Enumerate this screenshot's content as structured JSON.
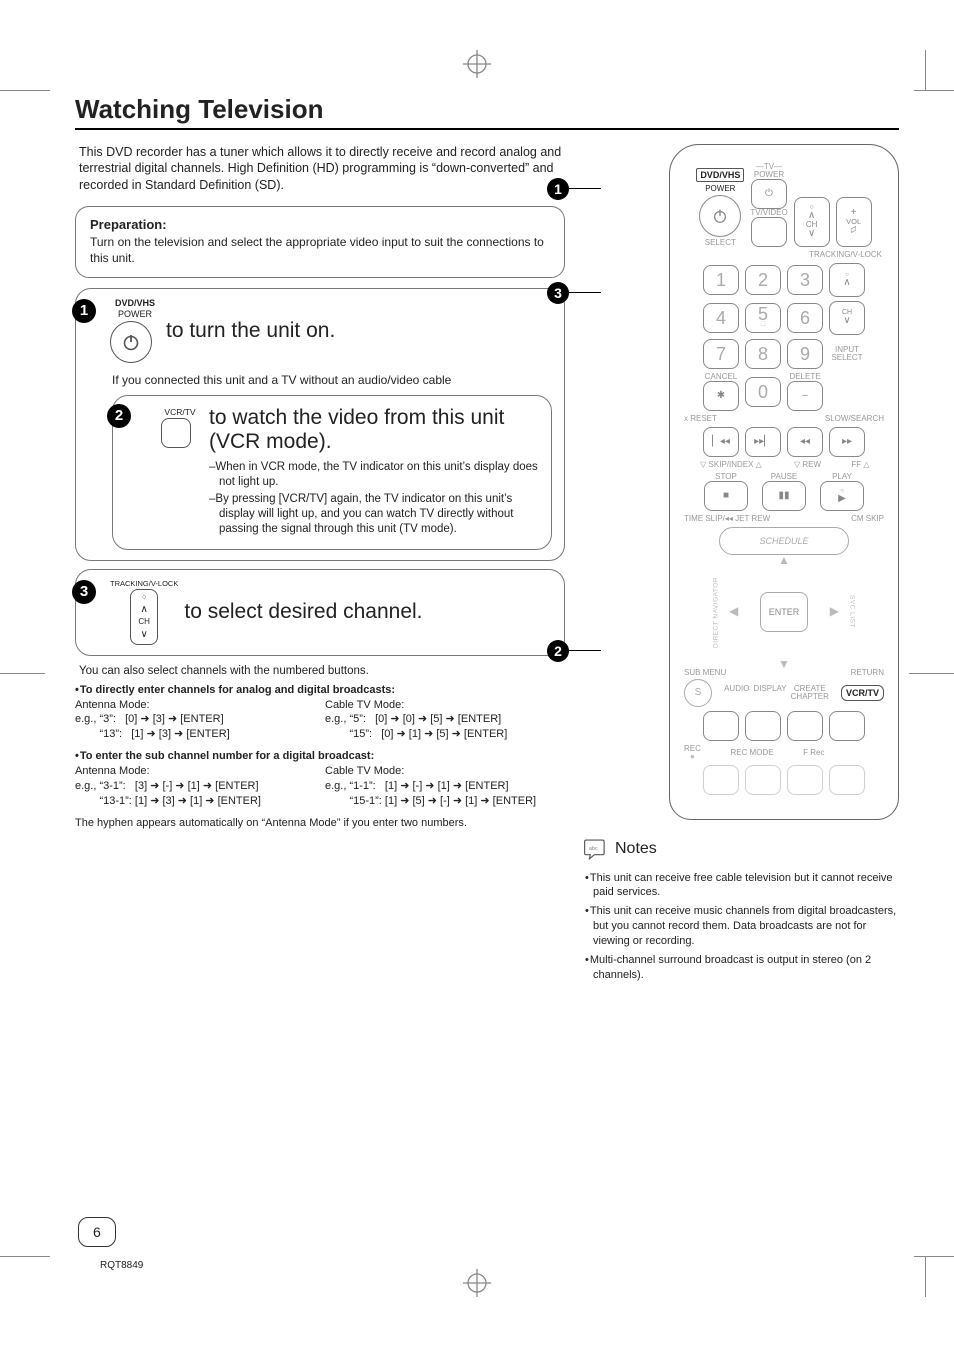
{
  "doc_code": "RQT8849",
  "page_number": "6",
  "title": "Watching Television",
  "intro": "This DVD recorder has a tuner which allows it to directly receive and record analog and terrestrial digital channels. High Definition (HD) programming is “down-converted” and recorded in Standard Definition (SD).",
  "preparation": {
    "heading": "Preparation:",
    "body": "Turn on the television and select the appropriate video input to suit the connections to this unit."
  },
  "step1": {
    "btn_label1": "DVD/VHS",
    "btn_label2": "POWER",
    "text": "to turn the unit on."
  },
  "cable_note": "If you connected this unit and a TV without an audio/video cable",
  "step2": {
    "btn_label": "VCR/TV",
    "line1": "to watch the video from this unit",
    "line2": "(VCR mode).",
    "sub1": "–When in VCR mode, the TV indicator on this unit’s display does not light up.",
    "sub2": "–By pressing [VCR/TV] again, the TV indicator on this unit’s display will light up, and you can watch TV directly without passing the signal through this unit (TV mode)."
  },
  "step3": {
    "btn_label": "TRACKING/V-LOCK",
    "ch_label": "CH",
    "text": "to select desired channel."
  },
  "channels": {
    "intro": "You can also select channels with the numbered buttons.",
    "head_a": "To directly enter channels for analog and digital broadcasts:",
    "antenna_title": "Antenna Mode:",
    "cable_title": "Cable TV Mode:",
    "ant_l1": "e.g., “3”:   [0] ➜ [3] ➜ [ENTER]",
    "ant_l2": "        “13”:   [1] ➜ [3] ➜ [ENTER]",
    "cab_l1": "e.g., “5”:   [0] ➜ [0] ➜ [5] ➜ [ENTER]",
    "cab_l2": "        “15”:   [0] ➜ [1] ➜ [5] ➜ [ENTER]",
    "head_b": "To enter the sub channel number for a digital broadcast:",
    "ant_b1": "e.g., “3-1”:   [3] ➜ [-] ➜ [1] ➜ [ENTER]",
    "ant_b2": "        “13-1”: [1] ➜ [3] ➜ [1] ➜ [ENTER]",
    "cab_b1": "e.g., “1-1”:   [1] ➜ [-] ➜ [1] ➜ [ENTER]",
    "cab_b2": "        “15-1”: [1] ➜ [5] ➜ [-] ➜ [1] ➜ [ENTER]",
    "hyphen": "The hyphen appears automatically on “Antenna Mode” if you enter two numbers."
  },
  "remote": {
    "dvdvhs": "DVD/VHS",
    "power": "POWER",
    "tv": "TV",
    "tvpower": "POWER",
    "select": "SELECT",
    "tvvideo": "TV/VIDEO",
    "ch": "CH",
    "vol": "VOL",
    "trackvlock": "TRACKING/V-LOCK",
    "input_select": "INPUT SELECT",
    "nums": [
      "1",
      "2",
      "3",
      "4",
      "5",
      "6",
      "7",
      "8",
      "9",
      "0"
    ],
    "cancel": "CANCEL",
    "star": "✱",
    "delete": "DELETE",
    "dash": "–",
    "reset": "x RESET",
    "slow": "SLOW/SEARCH",
    "skipindex": "▽ SKIP/INDEX △",
    "rew_lbl": "▽ REW",
    "ff_lbl": "FF △",
    "stop": "STOP",
    "pause": "PAUSE",
    "play": "PLAY",
    "timeslip": "TIME SLIP/◂◂ JET REW",
    "cmskip": "CM SKIP",
    "schedule": "SCHEDULE",
    "enter": "ENTER",
    "direct_nav": "DIRECT NAVIGATOR",
    "svc_list": "SVC LIST",
    "submenu": "SUB MENU",
    "return": "RETURN",
    "s_btn": "S",
    "audio": "AUDIO",
    "display": "DISPLAY",
    "create": "CREATE",
    "chapter": "CHAPTER",
    "vcrtv": "VCR/TV",
    "rec": "REC",
    "recmode": "REC MODE",
    "frec": "F Rec"
  },
  "notes": {
    "heading": "Notes",
    "n1": "This unit can receive free cable television but it cannot receive paid services.",
    "n2": "This unit can receive music channels from digital broadcasters, but you cannot record them. Data broadcasts are not for viewing or recording.",
    "n3": "Multi-channel surround broadcast is output in stereo (on 2 channels)."
  }
}
